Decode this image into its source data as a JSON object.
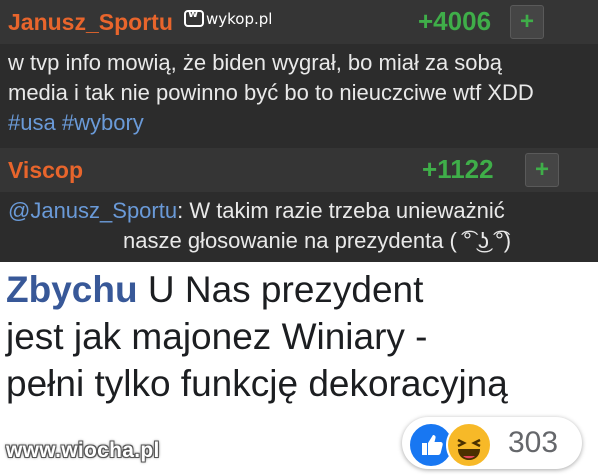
{
  "wykop": {
    "logo_text": "wykop.pl",
    "comments": [
      {
        "author": "Janusz_Sportu",
        "score": "+4006",
        "plus_label": "+",
        "line1": "w tvp info mowią, że biden wygrał, bo miał za sobą",
        "line2": "media i tak nie powinno być bo to nieuczciwe wtf XDD",
        "tag1": "#usa",
        "tag2": "#wybory"
      },
      {
        "author": "Viscop",
        "score": "+1122",
        "plus_label": "+",
        "mention": "@Janusz_Sportu",
        "line1_rest": ": W takim razie trzeba unieważnić",
        "line2": "nasze głosowanie na prezydenta ( ͡° ͜ʖ ͡°)"
      }
    ]
  },
  "facebook": {
    "name": "Zbychu",
    "text_line1": "U Nas prezydent",
    "text_line2": "jest jak majonez Winiary -",
    "text_line3": "pełni tylko funkcję dekoracyjną",
    "reaction_count": "303",
    "reactions": [
      "like-icon",
      "haha-icon"
    ],
    "colors": {
      "like": "#1877f2",
      "haha": "#f7b928",
      "name": "#385898"
    }
  },
  "watermark": "www.wiocha.pl"
}
